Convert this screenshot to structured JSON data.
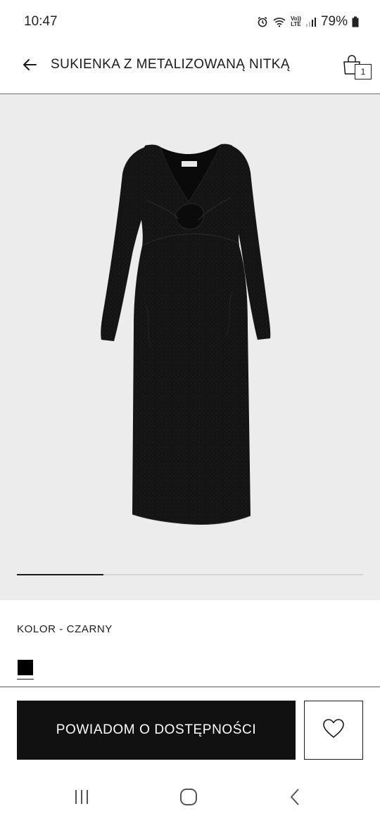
{
  "status_bar": {
    "time": "10:47",
    "battery_percent": "79%",
    "network_lines": [
      "Vo))",
      "LTE"
    ],
    "icons": [
      "alarm-icon",
      "wifi-icon",
      "volte-lte-icon",
      "signal-icon",
      "battery-icon"
    ]
  },
  "header": {
    "title": "SUKIENKA Z METALIZOWANĄ NITKĄ",
    "back_icon": "arrow-left-icon",
    "cart_icon": "shopping-bag-icon",
    "cart_count": "1"
  },
  "gallery": {
    "image": "black-long-sleeve-metallic-dress",
    "background_color": "#ececec",
    "progress_fraction": 0.25
  },
  "product": {
    "color_label": "KOLOR - CZARNY",
    "swatches": [
      {
        "color": "#000000",
        "selected": true
      }
    ]
  },
  "actions": {
    "notify_label": "POWIADOM O DOSTĘPNOŚCI",
    "wishlist_icon": "heart-icon"
  },
  "nav_bar": {
    "icons": [
      "recent-apps-icon",
      "home-icon",
      "back-icon"
    ]
  }
}
